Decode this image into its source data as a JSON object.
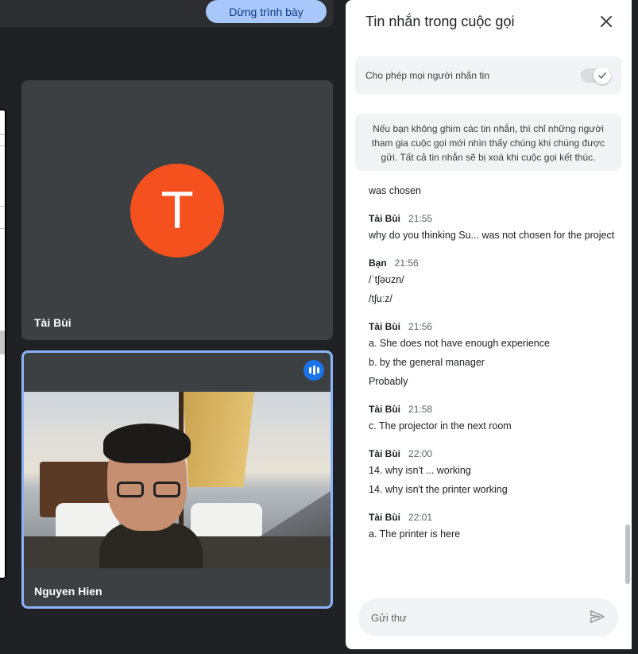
{
  "toolbar": {
    "stop_presenting_label": "Dừng trình bày"
  },
  "tiles": [
    {
      "name": "Tài Bùi",
      "avatar_letter": "T",
      "avatar_color": "#f4511e"
    },
    {
      "name": "Nguyen Hien",
      "speaking": true
    }
  ],
  "chat": {
    "title": "Tin nhắn trong cuộc gọi",
    "allow_label": "Cho phép mọi người nhắn tin",
    "allow_enabled": true,
    "notice": "Nếu bạn không ghim các tin nhắn, thì chỉ những người tham gia cuộc gọi mới nhìn thấy chúng khi chúng được gửi. Tất cả tin nhắn sẽ bị xoá khi cuộc gọi kết thúc.",
    "messages": [
      {
        "sender": "",
        "time": "",
        "lines": [
          "was chosen"
        ]
      },
      {
        "sender": "Tài Bùi",
        "time": "21:55",
        "lines": [
          "why do you thinking Su... was not chosen for the project"
        ]
      },
      {
        "sender": "Bạn",
        "time": "21:56",
        "lines": [
          "/ˈtʃəʊzn/",
          "/tʃuːz/"
        ]
      },
      {
        "sender": "Tài Bùi",
        "time": "21:56",
        "lines": [
          "a. She does not have enough experience",
          "b. by the general manager",
          "Probably"
        ]
      },
      {
        "sender": "Tài Bùi",
        "time": "21:58",
        "lines": [
          "c. The projector in the next room"
        ]
      },
      {
        "sender": "Tài Bùi",
        "time": "22:00",
        "lines": [
          "14. why isn't ... working",
          "14. why isn't the printer working"
        ]
      },
      {
        "sender": "Tài Bùi",
        "time": "22:01",
        "lines": [
          "a. The printer is here"
        ]
      }
    ],
    "compose_placeholder": "Gửi thư"
  },
  "colors": {
    "accent": "#a8c7fa",
    "speaking_ring": "#8ab4f8",
    "speaking_badge": "#1a73e8"
  },
  "icons": {
    "close": "close-icon",
    "check": "check-icon",
    "send": "send-icon",
    "speaking": "audio-level-icon"
  }
}
